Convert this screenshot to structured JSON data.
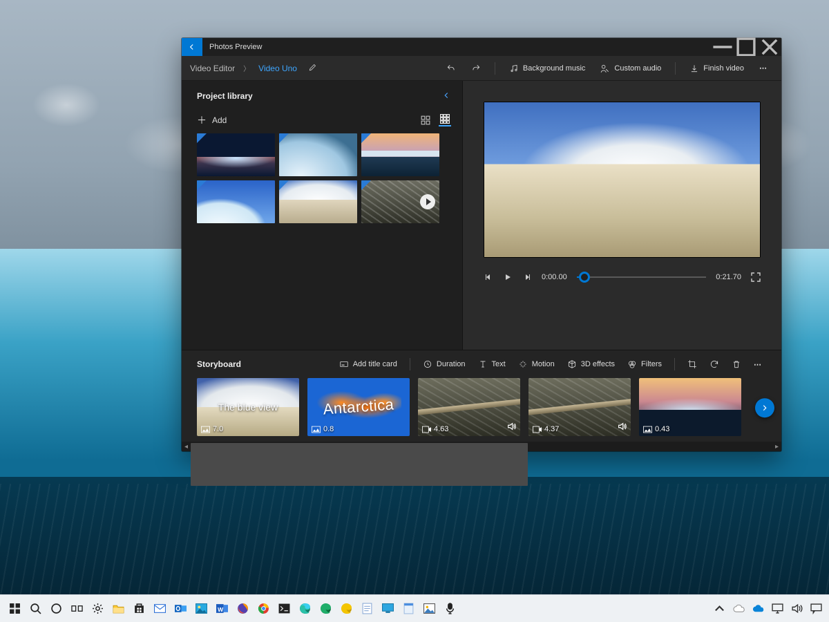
{
  "app": {
    "title": "Photos Preview"
  },
  "breadcrumb": {
    "root": "Video Editor",
    "leaf": "Video Uno"
  },
  "toolbar": {
    "bg_music": "Background music",
    "custom_audio": "Custom audio",
    "finish": "Finish video"
  },
  "library": {
    "title": "Project library",
    "add": "Add"
  },
  "player": {
    "current": "0:00.00",
    "total": "0:21.70"
  },
  "storyboard": {
    "title": "Storyboard",
    "tools": {
      "title_card": "Add title card",
      "duration": "Duration",
      "text": "Text",
      "motion": "Motion",
      "effects": "3D effects",
      "filters": "Filters"
    },
    "cards": [
      {
        "overlay": "The blue view",
        "duration": "7.0",
        "icon": "image"
      },
      {
        "overlay": "Antarctica",
        "duration": "0.8",
        "icon": "image"
      },
      {
        "overlay": "",
        "duration": "4.63",
        "icon": "video",
        "sound": true
      },
      {
        "overlay": "",
        "duration": "4.37",
        "icon": "video",
        "sound": true
      },
      {
        "overlay": "",
        "duration": "0.43",
        "icon": "image"
      }
    ]
  },
  "taskbar": {
    "time": ""
  }
}
